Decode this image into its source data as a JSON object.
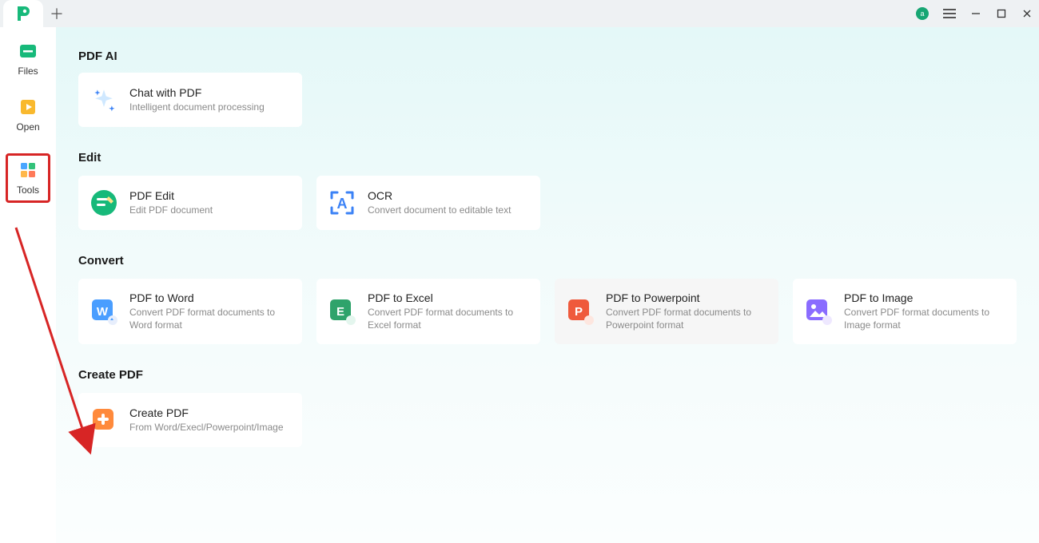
{
  "titlebar": {
    "avatar_letter": "a"
  },
  "sidebar": {
    "items": [
      {
        "label": "Files"
      },
      {
        "label": "Open"
      },
      {
        "label": "Tools"
      }
    ]
  },
  "sections": {
    "pdf_ai": {
      "heading": "PDF AI",
      "cards": [
        {
          "title": "Chat with PDF",
          "desc": "Intelligent document processing"
        }
      ]
    },
    "edit": {
      "heading": "Edit",
      "cards": [
        {
          "title": "PDF Edit",
          "desc": "Edit PDF document"
        },
        {
          "title": "OCR",
          "desc": "Convert document to editable text"
        }
      ]
    },
    "convert": {
      "heading": "Convert",
      "cards": [
        {
          "title": "PDF to Word",
          "desc": "Convert PDF format documents to Word format"
        },
        {
          "title": "PDF to Excel",
          "desc": "Convert PDF format documents to Excel format"
        },
        {
          "title": "PDF to Powerpoint",
          "desc": "Convert PDF format documents to Powerpoint format"
        },
        {
          "title": "PDF to Image",
          "desc": "Convert PDF format documents to Image format"
        }
      ]
    },
    "create": {
      "heading": "Create PDF",
      "cards": [
        {
          "title": "Create PDF",
          "desc": "From Word/Execl/Powerpoint/Image"
        }
      ]
    }
  }
}
